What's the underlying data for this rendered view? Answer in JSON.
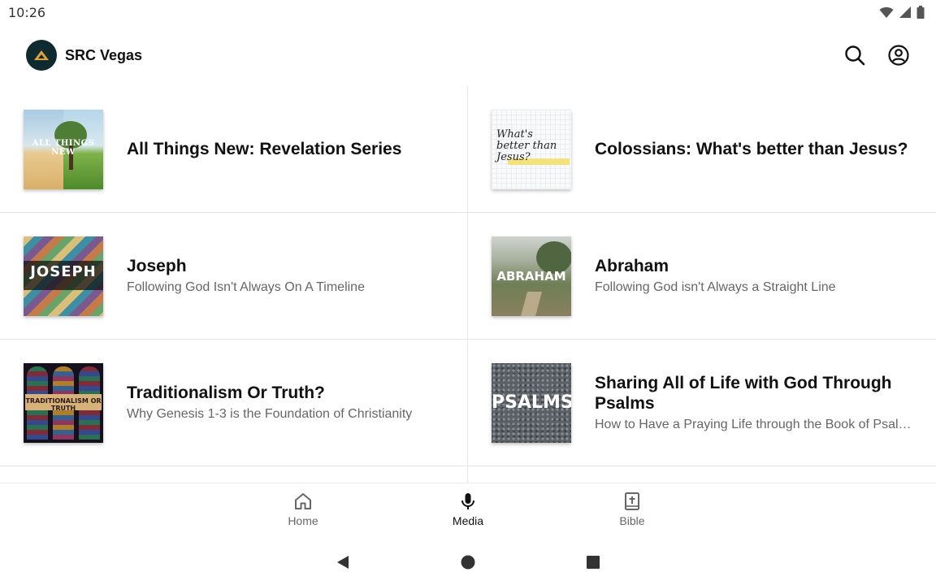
{
  "status_bar": {
    "time": "10:26"
  },
  "app": {
    "title": "SRC Vegas"
  },
  "series": [
    {
      "title": "All Things New: Revelation Series",
      "subtitle": "",
      "thumb_text": "ALL THINGS NEW"
    },
    {
      "title": "Colossians: What's better than Jesus?",
      "subtitle": "",
      "thumb_text": "What's better than Jesus?"
    },
    {
      "title": "Joseph",
      "subtitle": "Following God Isn't Always On A Timeline",
      "thumb_text": "JOSEPH"
    },
    {
      "title": "Abraham",
      "subtitle": "Following God isn't Always a Straight Line",
      "thumb_text": "ABRAHAM"
    },
    {
      "title": "Traditionalism Or Truth?",
      "subtitle": "Why Genesis 1-3 is the Foundation of Christianity",
      "thumb_text": "TRADITIONALISM OR TRUTH"
    },
    {
      "title": "Sharing All of Life with God Through Psalms",
      "subtitle": "How to Have a Praying Life through the Book of Psalms",
      "thumb_text": "PSALMS"
    }
  ],
  "bottom_nav": [
    {
      "label": "Home",
      "icon": "home-icon",
      "active": false
    },
    {
      "label": "Media",
      "icon": "microphone-icon",
      "active": true
    },
    {
      "label": "Bible",
      "icon": "bible-icon",
      "active": false
    }
  ],
  "colors": {
    "logo_bg": "#0f2b30",
    "logo_accent": "#e0a23a",
    "divider": "#e6e6e6"
  }
}
